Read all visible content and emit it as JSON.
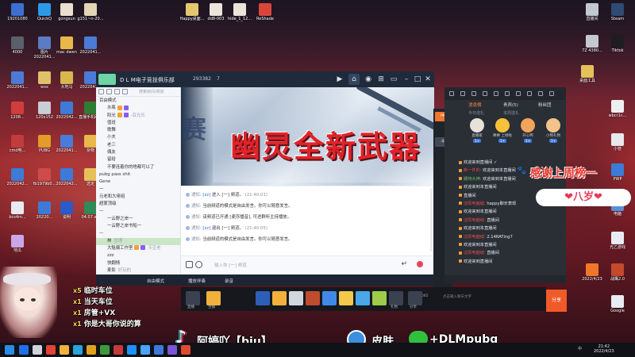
{
  "desktop": {
    "icons_left": [
      {
        "label": "19201080",
        "color": "#3d6fd1"
      },
      {
        "label": "QuickQ",
        "color": "#2b9be8"
      },
      {
        "label": "gongsun",
        "color": "#e9e0cf"
      },
      {
        "label": "g151~n-20...",
        "color": "#e3d6b6"
      },
      {
        "label": "4000",
        "color": "#59606b"
      },
      {
        "label": "图片 2022041...",
        "color": "#5b7bc4"
      },
      {
        "label": "mac dwen",
        "color": "#e9b84a"
      },
      {
        "label": "2022041...",
        "color": "#4a7bd6"
      },
      {
        "label": "2022041...",
        "color": "#4a7bd6"
      },
      {
        "label": "wxx",
        "color": "#e1c06a"
      },
      {
        "label": "大地马",
        "color": "#d8b84c"
      },
      {
        "label": "2022041...",
        "color": "#4a7bd6"
      },
      {
        "label": "1208...",
        "color": "#cf3e3a"
      },
      {
        "label": "120x152",
        "color": "#c9cdd5"
      },
      {
        "label": "2022042...",
        "color": "#3e7ad8"
      },
      {
        "label": "直播手机助...",
        "color": "#2e7d32"
      },
      {
        "label": "cmd电...",
        "color": "#c23c3c"
      },
      {
        "label": "PUBG",
        "color": "#e39b2a"
      },
      {
        "label": "2022041...",
        "color": "#4a7bd6"
      },
      {
        "label": "杂物",
        "color": "#e9b84a"
      },
      {
        "label": "2022042...",
        "color": "#3e7ad8"
      },
      {
        "label": "fb1979b0...",
        "color": "#cf4a4a"
      },
      {
        "label": "2022042...",
        "color": "#3e7ad8"
      },
      {
        "label": "选定",
        "color": "#e6c15a"
      },
      {
        "label": "bcs4m...",
        "color": "#e8eaef"
      },
      {
        "label": "20220...",
        "color": "#3e7ad8"
      },
      {
        "label": "说明",
        "color": "#2b5ac9"
      },
      {
        "label": "04.07.xls",
        "color": "#2e8b57"
      },
      {
        "label": "地瓜",
        "color": "#c9a7e8"
      }
    ],
    "icons_right": [
      {
        "label": "Happy桌面...",
        "color": "#e5c770"
      },
      {
        "label": "dd8-003",
        "color": "#eae5da"
      },
      {
        "label": "hide_1_12...",
        "color": "#eae5da"
      },
      {
        "label": "ReShade",
        "color": "#d8463a"
      },
      {
        "label": "直播间",
        "color": "#c2c8d2"
      },
      {
        "label": "Steam",
        "color": "#2f4a73"
      },
      {
        "label": "7Z 4380...",
        "color": "#c4c9cf"
      },
      {
        "label": "Tiktok",
        "color": "#1e1e22"
      },
      {
        "label": "桌面工具",
        "color": "#e6c15a"
      },
      {
        "label": "wbcr1c...",
        "color": "#efefef"
      },
      {
        "label": "小管",
        "color": "#e6e8ec"
      },
      {
        "label": "PWP",
        "color": "#3d7bd8"
      },
      {
        "label": "电脑",
        "color": "#5b8fd6"
      },
      {
        "label": "光乙游戏",
        "color": "#e8ecf2"
      },
      {
        "label": "战鹰2.0",
        "color": "#c44a2e"
      },
      {
        "label": "2022/4/23",
        "color": "#f0762a"
      },
      {
        "label": "Google",
        "color": "#e8ecf2"
      }
    ]
  },
  "chat_window": {
    "title": "D L M电子竞技俱乐部",
    "room_id": "293382",
    "online": "7",
    "left_panel": {
      "search_placeholder": "搜索房间/频道",
      "tree": [
        {
          "text": "百由模式",
          "tail": "",
          "level": 0
        },
        {
          "text": "水瓶",
          "tail": "",
          "level": 1,
          "badge": true
        },
        {
          "text": "阳光",
          "tail": "·耳光乐",
          "level": 1,
          "badge": true
        },
        {
          "text": "值班",
          "tail": "",
          "level": 1
        },
        {
          "text": "歌舞",
          "tail": "",
          "level": 1
        },
        {
          "text": "小夫",
          "tail": "",
          "level": 1
        },
        {
          "text": "老三",
          "tail": "",
          "level": 1
        },
        {
          "text": "偶友",
          "tail": "",
          "level": 1
        },
        {
          "text": "留给",
          "tail": "",
          "level": 1
        },
        {
          "text": "不要连着你的啥都可以了",
          "tail": "",
          "level": 1
        },
        {
          "text": "pubg pass shit",
          "tail": "",
          "level": 0
        },
        {
          "text": "Gene",
          "tail": "",
          "level": 0
        },
        {
          "text": "一",
          "tail": "",
          "level": 0
        },
        {
          "text": "元老和大佬组",
          "tail": "",
          "level": 0
        },
        {
          "text": "超蒙顶级",
          "tail": "",
          "level": 0
        },
        {
          "text": "—",
          "tail": "",
          "level": 0
        },
        {
          "text": "一云野之岸一",
          "tail": "",
          "level": 1
        },
        {
          "text": "一云野之岸书船一",
          "tail": "",
          "level": 1
        },
        {
          "text": "—",
          "tail": "",
          "level": 0
        },
        {
          "text": "林",
          "tail": "管理",
          "level": 1,
          "selected": true
        },
        {
          "text": "大魁偏工作室",
          "tail": "天豆老",
          "level": 1,
          "badge": true
        },
        {
          "text": "zzz",
          "tail": "",
          "level": 1
        },
        {
          "text": "快翻情",
          "tail": "",
          "level": 1
        },
        {
          "text": "麦影",
          "tail": "好玩的",
          "level": 1
        }
      ],
      "footer": [
        "自由模式",
        "播放伴奏",
        "录音"
      ]
    },
    "video": {
      "big_text": "幽灵全新武器",
      "side_text": "赛",
      "number": "59"
    },
    "messages": [
      {
        "kind": "通知:",
        "who": "[zz]",
        "text": "进入 [一] 频道。",
        "time": "(21:40:01)"
      },
      {
        "kind": "通知:",
        "who": "",
        "text": "当前频道的模式是自由发言。你可以随意发言。",
        "time": ""
      },
      {
        "kind": "通知:",
        "who": "",
        "text": "该频道已开通 [麦序播音], 可进群听主持播放。",
        "time": ""
      },
      {
        "kind": "通知:",
        "who": "[zz]",
        "text": "退出 [一] 频道。",
        "time": "(21:40:05)"
      },
      {
        "kind": "通知:",
        "who": "",
        "text": "当前频道的模式是自由发言。你可以随意发言。",
        "time": ""
      }
    ],
    "input_placeholder": "输入你 [一] 频道"
  },
  "stream_panel": {
    "tabs": [
      "消息榜",
      "贵宾(5)",
      "粉丝团",
      "贵宾榜"
    ],
    "sub_tabs": [
      "今日送礼",
      "本周送礼"
    ],
    "gifts": [
      {
        "name": "直播家",
        "pill": "1+",
        "color": "#e7e2d9"
      },
      {
        "name": "棒棒 上榜啦",
        "pill": "1+",
        "color": "#f6c23c"
      },
      {
        "name": "开心鸭",
        "pill": "1+",
        "color": "#f3a45a"
      },
      {
        "name": "小熊礼物",
        "pill": "1+",
        "color": "#f2c48a"
      }
    ],
    "feed": [
      {
        "name": "",
        "text": "欢迎来到直播间 ✓"
      },
      {
        "name": "新一件的",
        "text": "欢迎来到本直播间"
      },
      {
        "name": "期待大神",
        "text": "欢迎来到本直播间"
      },
      {
        "name": "",
        "text": "欢迎来到本直播间"
      },
      {
        "name": "",
        "text": "直播间"
      },
      {
        "name": "沈阳电脑城",
        "text": "happy聊天表现"
      },
      {
        "name": "",
        "text": "欢迎来到本直播间"
      },
      {
        "name": "沈阳电脑城",
        "text": "直播间"
      },
      {
        "name": "",
        "text": "欢迎来到本直播间"
      },
      {
        "name": "沈阳电脑城",
        "text": "2.14RATing7"
      },
      {
        "name": "",
        "text": "欢迎来到本直播间"
      },
      {
        "name": "沈阳电脑城",
        "text": "直播间"
      },
      {
        "name": "",
        "text": "欢迎来到直播间"
      }
    ],
    "input_placeholder": "点击输入聊天文字",
    "share_label": "分享"
  },
  "overlay": {
    "thanks_text": "感谢上周榜一",
    "age_text": "❤八岁❤",
    "gift_lines": [
      {
        "count": "x5",
        "text": "临时车位"
      },
      {
        "count": "x1",
        "text": "当天车位"
      },
      {
        "count": "x1",
        "text": "房管+VX"
      },
      {
        "count": "x1",
        "text": "你是大哥你说的算"
      }
    ],
    "brand_tiktok": "阿婷吖【biu】",
    "brand_skin": "皮肤",
    "brand_wechat": "+DLMpubg"
  },
  "game_bar": {
    "labels": [
      "直播",
      "主播",
      "礼物",
      "分享"
    ],
    "items_colors": [
      "#2d5fb8",
      "#f2b13a",
      "#d2d7df",
      "#c04b2e",
      "#3f8ae6",
      "#f2c94a",
      "#4aa7e8",
      "#9ecb4a"
    ],
    "small_text": [
      "音量",
      "帮助",
      "4065"
    ]
  },
  "taskbar": {
    "time": "21:42",
    "date": "2022/4/23",
    "tray_lang": "中"
  }
}
